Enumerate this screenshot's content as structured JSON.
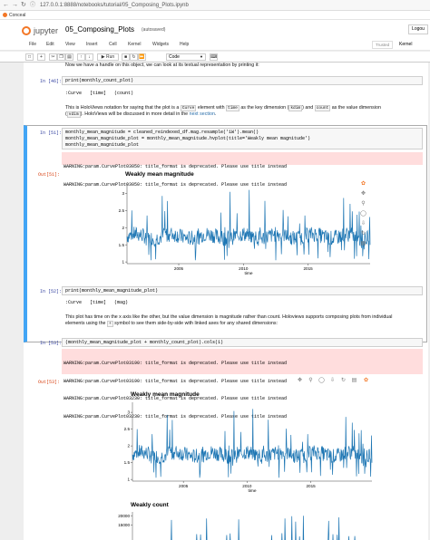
{
  "browser": {
    "url": "127.0.0.1:8888/notebooks/tutorial/05_Composing_Plots.ipynb",
    "bookmark": "Conceal"
  },
  "header": {
    "logo_text": "jupyter",
    "notebook_title": "05_Composing_Plots",
    "save_status": "(autosaved)",
    "logout": "Logou"
  },
  "menu": {
    "items": [
      "File",
      "Edit",
      "View",
      "Insert",
      "Cell",
      "Kernel",
      "Widgets",
      "Help"
    ],
    "trusted": "Trusted",
    "kernel": "Kernel"
  },
  "toolbar": {
    "run_label": "Run",
    "cell_type": "Code"
  },
  "cells": {
    "intro_text": "Now we have a handle on this object, we can look at its textual representation by printing it:",
    "c46_prompt": "In [46]:",
    "c46_code": "print(monthly_count_plot)",
    "c46_output": ":Curve   [time]   (count)",
    "md1_a": "This is HoloViews notation for saying that the plot is a",
    "md1_curve": "Curve",
    "md1_b": "element with",
    "md1_time": "time",
    "md1_c": "as the key dimension (",
    "md1_kdim": "kdim",
    "md1_d": ") and",
    "md1_count": "count",
    "md1_e": "as the value dimension",
    "md1_f": "(",
    "md1_vdim": "vdim",
    "md1_g": "). HoloViews will be discussed in more detail in the",
    "md1_link": "next section",
    "md1_h": ".",
    "c51_prompt": "In [51]:",
    "c51_line1": "monthly_mean_magnitude = cleaned_reindexed_df.mag.resample('1W').mean()",
    "c51_line2": "monthly_mean_magnitude_plot = monthly_mean_magnitude.hvplot(title='Weakly mean magnitude')",
    "c51_line3": "monthly_mean_magnitude_plot",
    "c51_warn1": "WARNING:param.CurvePlot03050: title_format is deprecated. Please use title instead",
    "c51_warn2": "WARNING:param.CurvePlot03050: title_format is deprecated. Please use title instead",
    "c51_out_prompt": "Out[51]:",
    "c52_prompt": "In [52]:",
    "c52_code": "print(monthly_mean_magnitude_plot)",
    "c52_output": ":Curve   [time]   (mag)",
    "md2_line1": "This plot has time on the x axis like the other, but the value dimension is magnitude rather than count. Holoviews supports composing plots from individual",
    "md2_a": "elements using the",
    "md2_plus": "+",
    "md2_b": "symbol to see them side-by-side with linked axes for any shared dimensions:",
    "c53_prompt": "In [53]:",
    "c53_code": "(monthly_mean_magnitude_plot + monthly_count_plot).cols(1)",
    "c53_warn1": "WARNING:param.CurvePlot03190: title_format is deprecated. Please use title instead",
    "c53_warn2": "WARNING:param.CurvePlot03190: title_format is deprecated. Please use title instead",
    "c53_warn3": "WARNING:param.CurvePlot03230: title_format is deprecated. Please use title instead",
    "c53_warn4": "WARNING:param.CurvePlot03230: title_format is deprecated. Please use title instead",
    "c53_out_prompt": "Out[53]:"
  },
  "colors": {
    "accent": "#1f77b4",
    "warning_bg": "#ffdddd",
    "selected_border": "#42a5f5",
    "jupyter_orange": "#f37726"
  },
  "chart_data": [
    {
      "type": "line",
      "title": "Weakly mean magnitude",
      "xlabel": "time",
      "ylabel": "",
      "x_ticks": [
        "2005",
        "2010",
        "2015"
      ],
      "y_ticks": [
        "1",
        "1.5",
        "2",
        "2.5",
        "3"
      ],
      "xlim": [
        2001,
        2019.8
      ],
      "ylim": [
        0.95,
        3.3
      ],
      "series": [
        {
          "name": "",
          "values_summary": "weekly mean magnitude fluctuating mostly between 1.4 and 2.1 with spikes up to ~3.0",
          "color": "#1f77b4"
        }
      ]
    },
    {
      "type": "line",
      "title": "Weakly mean magnitude",
      "xlabel": "time",
      "ylabel": "",
      "x_ticks": [
        "2005",
        "2010",
        "2015"
      ],
      "y_ticks": [
        "1",
        "1.5",
        "2",
        "2.5",
        "3"
      ],
      "xlim": [
        2001,
        2019.8
      ],
      "ylim": [
        0.95,
        3.3
      ]
    },
    {
      "type": "line",
      "title": "Weakly count",
      "y_ticks": [
        "20000",
        "15000"
      ],
      "ylim": [
        0,
        22000
      ]
    }
  ]
}
